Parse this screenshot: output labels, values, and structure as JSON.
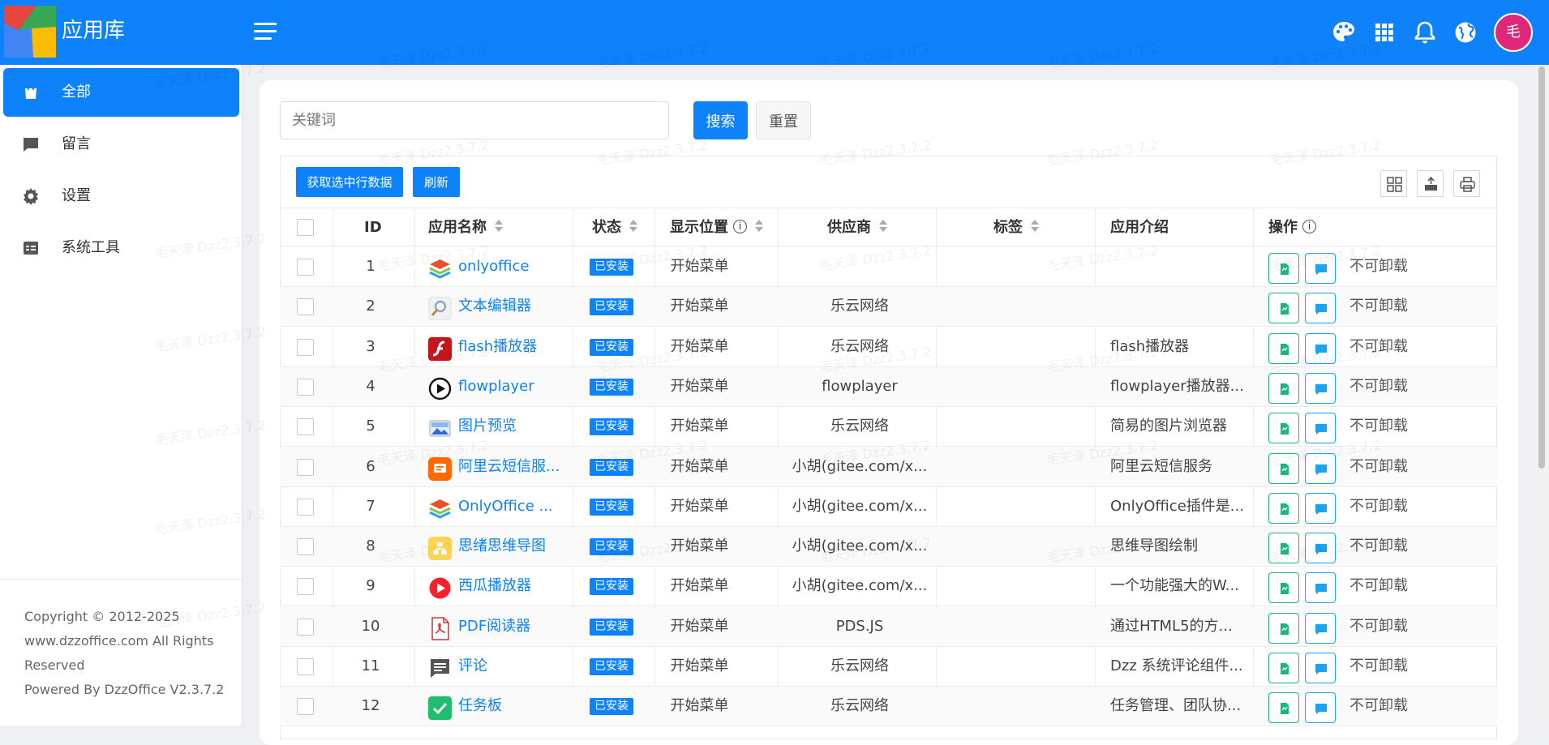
{
  "header": {
    "title": "应用库",
    "avatar_text": "毛",
    "icons": [
      "palette-icon",
      "apps-grid-icon",
      "bell-icon",
      "globe-icon"
    ],
    "bg_color": "#0d82fb"
  },
  "sidebar": {
    "items": [
      {
        "label": "全部",
        "icon": "bag-icon",
        "active": true
      },
      {
        "label": "留言",
        "icon": "message-icon",
        "active": false
      },
      {
        "label": "设置",
        "icon": "gear-icon",
        "active": false
      },
      {
        "label": "系统工具",
        "icon": "tools-icon",
        "active": false
      }
    ],
    "copyright": [
      "Copyright © 2012-2025",
      "www.dzzoffice.com All Rights",
      "Reserved",
      "Powered By DzzOffice V2.3.7.2"
    ]
  },
  "search": {
    "placeholder": "关键词",
    "value": "",
    "search_label": "搜索",
    "reset_label": "重置"
  },
  "toolbar": {
    "get_selected_label": "获取选中行数据",
    "refresh_label": "刷新",
    "icons": [
      "columns-icon",
      "export-icon",
      "print-icon"
    ]
  },
  "table": {
    "columns": [
      "ID",
      "应用名称",
      "状态",
      "显示位置",
      "供应商",
      "标签",
      "应用介绍",
      "操作"
    ],
    "rows": [
      {
        "id": "1",
        "name": "onlyoffice",
        "status": "已安装",
        "position": "开始菜单",
        "vendor": "",
        "tag": "",
        "intro": "",
        "action": "不可卸载",
        "icon": "onlyoffice-icon"
      },
      {
        "id": "2",
        "name": "文本编辑器",
        "status": "已安装",
        "position": "开始菜单",
        "vendor": "乐云网络",
        "tag": "",
        "intro": "",
        "action": "不可卸载",
        "icon": "text-editor-icon"
      },
      {
        "id": "3",
        "name": "flash播放器",
        "status": "已安装",
        "position": "开始菜单",
        "vendor": "乐云网络",
        "tag": "",
        "intro": "flash播放器",
        "action": "不可卸载",
        "icon": "flash-icon"
      },
      {
        "id": "4",
        "name": "flowplayer",
        "status": "已安装",
        "position": "开始菜单",
        "vendor": "flowplayer",
        "tag": "",
        "intro": "flowplayer播放器...",
        "action": "不可卸载",
        "icon": "play-icon"
      },
      {
        "id": "5",
        "name": "图片预览",
        "status": "已安装",
        "position": "开始菜单",
        "vendor": "乐云网络",
        "tag": "",
        "intro": "简易的图片浏览器",
        "action": "不可卸载",
        "icon": "image-preview-icon"
      },
      {
        "id": "6",
        "name": "阿里云短信服...",
        "status": "已安装",
        "position": "开始菜单",
        "vendor": "小胡(gitee.com/x...",
        "tag": "",
        "intro": "阿里云短信服务",
        "action": "不可卸载",
        "icon": "sms-icon"
      },
      {
        "id": "7",
        "name": "OnlyOffice ...",
        "status": "已安装",
        "position": "开始菜单",
        "vendor": "小胡(gitee.com/x...",
        "tag": "",
        "intro": "OnlyOffice插件是...",
        "action": "不可卸载",
        "icon": "onlyoffice-icon"
      },
      {
        "id": "8",
        "name": "思绪思维导图",
        "status": "已安装",
        "position": "开始菜单",
        "vendor": "小胡(gitee.com/x...",
        "tag": "",
        "intro": "思维导图绘制",
        "action": "不可卸载",
        "icon": "mindmap-icon"
      },
      {
        "id": "9",
        "name": "西瓜播放器",
        "status": "已安装",
        "position": "开始菜单",
        "vendor": "小胡(gitee.com/x...",
        "tag": "",
        "intro": "一个功能强大的W...",
        "action": "不可卸载",
        "icon": "xigua-player-icon"
      },
      {
        "id": "10",
        "name": "PDF阅读器",
        "status": "已安装",
        "position": "开始菜单",
        "vendor": "PDS.JS",
        "tag": "",
        "intro": "通过HTML5的方...",
        "action": "不可卸载",
        "icon": "pdf-icon"
      },
      {
        "id": "11",
        "name": "评论",
        "status": "已安装",
        "position": "开始菜单",
        "vendor": "乐云网络",
        "tag": "",
        "intro": "Dzz 系统评论组件...",
        "action": "不可卸载",
        "icon": "comment-icon"
      },
      {
        "id": "12",
        "name": "任务板",
        "status": "已安装",
        "position": "开始菜单",
        "vendor": "乐云网络",
        "tag": "",
        "intro": "任务管理、团队协...",
        "action": "不可卸载",
        "icon": "taskboard-icon"
      }
    ]
  },
  "watermark": "毛天泽 Dzz2.3.7.2",
  "colors": {
    "accent": "#0d82fb",
    "action_green": "#19b87a",
    "action_blue": "#1aa3f0"
  }
}
